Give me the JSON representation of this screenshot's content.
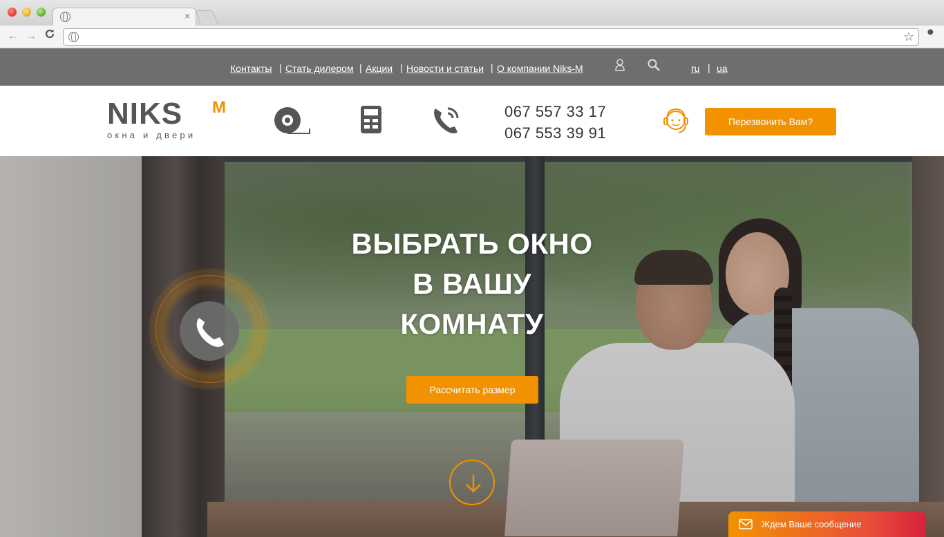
{
  "browser": {
    "tab_close": "×",
    "back": "←",
    "forward": "→",
    "reload": "C",
    "star": "☆",
    "wrench": "🔧"
  },
  "topnav": {
    "links": [
      "Контакты",
      "Стать дилером",
      "Акции",
      "Новости и статьи",
      "О компании Niks-M"
    ],
    "separator": "|",
    "lang": [
      "ru",
      "ua"
    ]
  },
  "header": {
    "logo_word": "NIKS",
    "logo_sup": "M",
    "logo_tagline": "окна и двери",
    "phone_1": "067 557 33 17",
    "phone_2": "067 553 39 91",
    "callback_label": "Перезвонить Вам?"
  },
  "hero": {
    "title_line_1": "ВЫБРАТЬ ОКНО",
    "title_line_2": "В ВАШУ",
    "title_line_3": "КОМНАТУ",
    "cta_label": "Рассчитать размер"
  },
  "chat": {
    "label": "Ждем Ваше сообщение"
  },
  "colors": {
    "accent": "#f39200",
    "nav_bg": "#6e6e6e"
  }
}
